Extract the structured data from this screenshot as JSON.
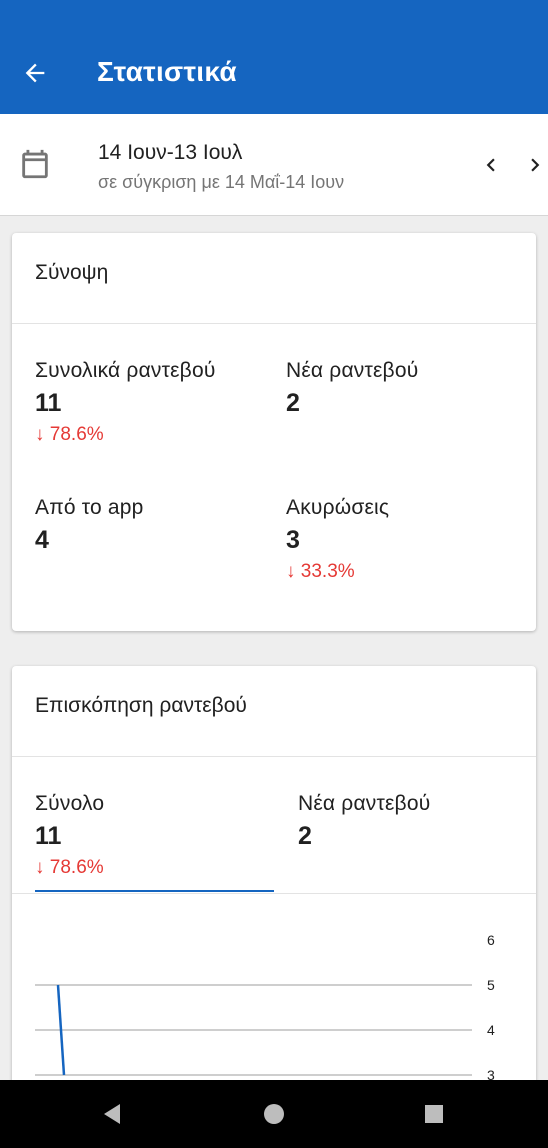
{
  "appbar": {
    "title": "Στατιστικά",
    "back_icon": "arrow-left-icon",
    "background": "#1565c0"
  },
  "date_range": {
    "range": "14 Ιουν-13 Ιουλ",
    "comparison": "σε σύγκριση με 14 Μαΐ-14 Ιουν",
    "calendar_icon": "calendar-icon",
    "prev_icon": "chevron-left-icon",
    "next_icon": "chevron-right-icon"
  },
  "summary": {
    "title": "Σύνοψη",
    "metrics": [
      {
        "label": "Συνολικά ραντεβού",
        "value": "11",
        "delta": "↓ 78.6%"
      },
      {
        "label": "Νέα ραντεβού",
        "value": "2",
        "delta": ""
      },
      {
        "label": "Από το app",
        "value": "4",
        "delta": ""
      },
      {
        "label": "Ακυρώσεις",
        "value": "3",
        "delta": "↓ 33.3%"
      }
    ]
  },
  "overview": {
    "title": "Επισκόπηση ραντεβού",
    "tabs": [
      {
        "label": "Σύνολο",
        "value": "11",
        "delta": "↓ 78.6%",
        "selected": true
      },
      {
        "label": "Νέα ραντεβού",
        "value": "2",
        "delta": "",
        "selected": false
      }
    ]
  },
  "chart_data": {
    "type": "line",
    "title": "",
    "xlabel": "",
    "ylabel": "",
    "y_ticks": [
      "6",
      "5",
      "4",
      "3"
    ],
    "ylim": [
      3,
      6
    ],
    "series": [
      {
        "values": [
          5,
          3
        ],
        "color": "#1565c0"
      }
    ],
    "grid": true
  },
  "colors": {
    "accent": "#1565c0",
    "negative": "#e53935"
  }
}
